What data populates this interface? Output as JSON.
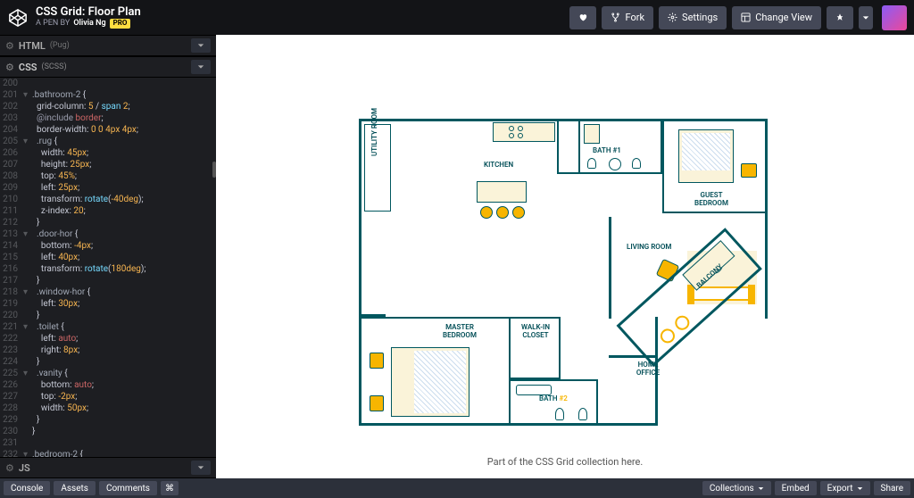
{
  "header": {
    "title": "CSS Grid: Floor Plan",
    "subtitle_prefix": "A PEN BY",
    "author": "Olivia Ng",
    "pro_badge": "PRO",
    "buttons": {
      "fork": "Fork",
      "settings": "Settings",
      "change_view": "Change View"
    }
  },
  "panels": {
    "html": {
      "lang": "HTML",
      "sub": "(Pug)"
    },
    "css": {
      "lang": "CSS",
      "sub": "(SCSS)"
    },
    "js": {
      "lang": "JS",
      "sub": ""
    }
  },
  "code": [
    {
      "n": "200",
      "f": "",
      "t": ""
    },
    {
      "n": "201",
      "f": "▾",
      "t": "<span class='c-sel'>.bathroom-2</span> {"
    },
    {
      "n": "202",
      "f": "",
      "t": "  <span class='c-prop'>grid-column</span>: <span class='c-num'>5</span> / <span class='c-kw'>span</span> <span class='c-num'>2</span>;"
    },
    {
      "n": "203",
      "f": "",
      "t": "  <span class='c-at'>@include</span> <span class='c-inc'>border</span>;"
    },
    {
      "n": "204",
      "f": "",
      "t": "  <span class='c-prop'>border-width</span>: <span class='c-num'>0 0 4px 4px</span>;"
    },
    {
      "n": "205",
      "f": "▾",
      "t": "  <span class='c-sel'>.rug</span> {"
    },
    {
      "n": "206",
      "f": "",
      "t": "    <span class='c-prop'>width</span>: <span class='c-num'>45px</span>;"
    },
    {
      "n": "207",
      "f": "",
      "t": "    <span class='c-prop'>height</span>: <span class='c-num'>25px</span>;"
    },
    {
      "n": "208",
      "f": "",
      "t": "    <span class='c-prop'>top</span>: <span class='c-num'>45%</span>;"
    },
    {
      "n": "209",
      "f": "",
      "t": "    <span class='c-prop'>left</span>: <span class='c-num'>25px</span>;"
    },
    {
      "n": "210",
      "f": "",
      "t": "    <span class='c-prop'>transform</span>: <span class='c-kw'>rotate</span>(<span class='c-deg'>-40deg</span>);"
    },
    {
      "n": "211",
      "f": "",
      "t": "    <span class='c-prop'>z-index</span>: <span class='c-num'>20</span>;"
    },
    {
      "n": "212",
      "f": "",
      "t": "  }"
    },
    {
      "n": "213",
      "f": "▾",
      "t": "  <span class='c-sel'>.door-hor</span> {"
    },
    {
      "n": "214",
      "f": "",
      "t": "    <span class='c-prop'>bottom</span>: <span class='c-num'>-4px</span>;"
    },
    {
      "n": "215",
      "f": "",
      "t": "    <span class='c-prop'>left</span>: <span class='c-num'>40px</span>;"
    },
    {
      "n": "216",
      "f": "",
      "t": "    <span class='c-prop'>transform</span>: <span class='c-kw'>rotate</span>(<span class='c-deg'>180deg</span>);"
    },
    {
      "n": "217",
      "f": "",
      "t": "  }"
    },
    {
      "n": "218",
      "f": "▾",
      "t": "  <span class='c-sel'>.window-hor</span> {"
    },
    {
      "n": "219",
      "f": "",
      "t": "    <span class='c-prop'>left</span>: <span class='c-num'>30px</span>;"
    },
    {
      "n": "220",
      "f": "",
      "t": "  }"
    },
    {
      "n": "221",
      "f": "▾",
      "t": "  <span class='c-sel'>.toilet</span> {"
    },
    {
      "n": "222",
      "f": "",
      "t": "    <span class='c-prop'>left</span>: <span class='c-auto'>auto</span>;"
    },
    {
      "n": "223",
      "f": "",
      "t": "    <span class='c-prop'>right</span>: <span class='c-num'>8px</span>;"
    },
    {
      "n": "224",
      "f": "",
      "t": "  }"
    },
    {
      "n": "225",
      "f": "▾",
      "t": "  <span class='c-sel'>.vanity</span> {"
    },
    {
      "n": "226",
      "f": "",
      "t": "    <span class='c-prop'>bottom</span>: <span class='c-auto'>auto</span>;"
    },
    {
      "n": "227",
      "f": "",
      "t": "    <span class='c-prop'>top</span>: <span class='c-num'>-2px</span>;"
    },
    {
      "n": "228",
      "f": "",
      "t": "    <span class='c-prop'>width</span>: <span class='c-num'>50px</span>;"
    },
    {
      "n": "229",
      "f": "",
      "t": "  }"
    },
    {
      "n": "230",
      "f": "",
      "t": "}"
    },
    {
      "n": "231",
      "f": "",
      "t": ""
    },
    {
      "n": "232",
      "f": "▾",
      "t": "<span class='c-sel'>.bedroom-2</span> {"
    }
  ],
  "floorplan": {
    "utility": "UTILITY ROOM",
    "kitchen": "KITCHEN",
    "bath1": "BATH #1",
    "guest": "GUEST BEDROOM",
    "living": "LIVING ROOM",
    "master": "MASTER BEDROOM",
    "closet": "WALK-IN CLOSET",
    "office": "HOME OFFICE",
    "bath2": "BATH #2",
    "balcony": "BALCONY"
  },
  "preview_caption": "Part of the CSS Grid collection here.",
  "footer": {
    "console": "Console",
    "assets": "Assets",
    "comments": "Comments",
    "collections": "Collections",
    "embed": "Embed",
    "export": "Export",
    "share": "Share"
  }
}
